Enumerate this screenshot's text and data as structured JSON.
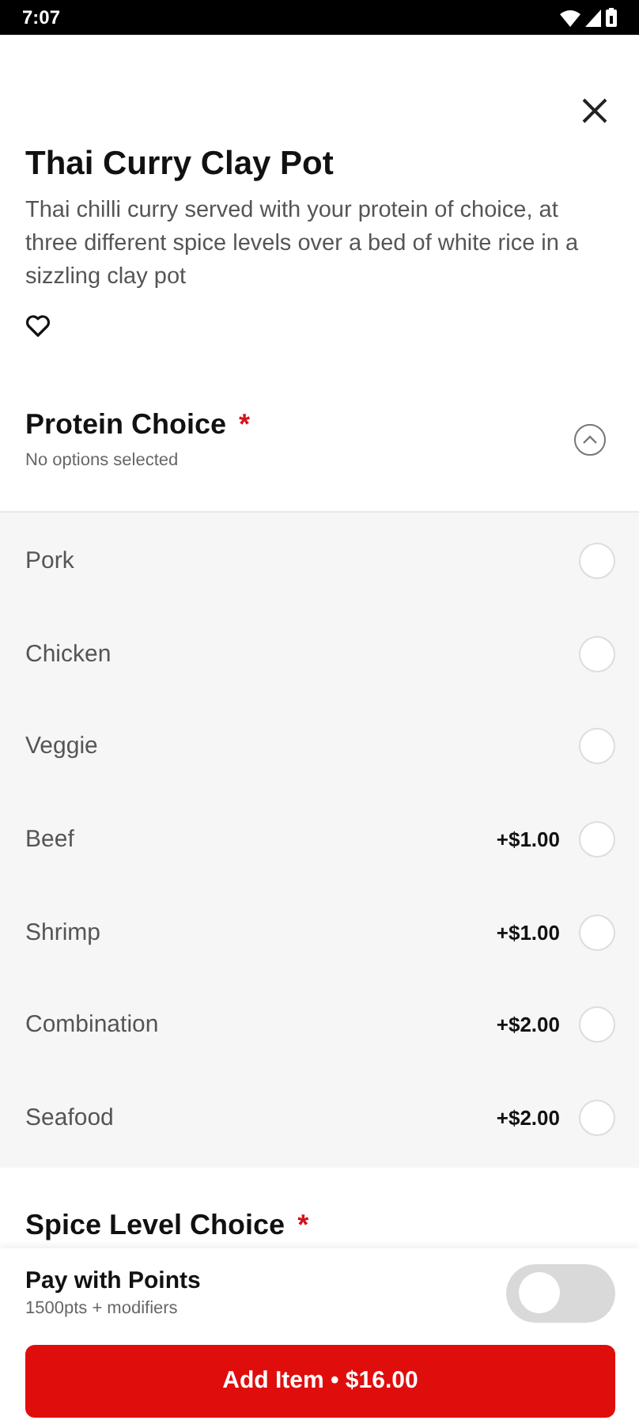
{
  "status_bar": {
    "time": "7:07"
  },
  "item": {
    "title": "Thai Curry Clay Pot",
    "description": "Thai chilli curry served with your protein of choice, at three different spice levels over a bed of white rice in a sizzling clay pot",
    "favorite": false
  },
  "sections": [
    {
      "title": "Protein Choice",
      "required_mark": "*",
      "status": "No options selected",
      "expanded": true,
      "options": [
        {
          "label": "Pork",
          "selected": false
        },
        {
          "label": "Chicken",
          "selected": false
        },
        {
          "label": "Veggie",
          "selected": false
        },
        {
          "label": "Beef",
          "price": "+$1.00",
          "selected": false
        },
        {
          "label": "Shrimp",
          "price": "+$1.00",
          "selected": false
        },
        {
          "label": "Combination",
          "price": "+$2.00",
          "selected": false
        },
        {
          "label": "Seafood",
          "price": "+$2.00",
          "selected": false
        }
      ]
    },
    {
      "title": "Spice Level Choice",
      "required_mark": "*"
    }
  ],
  "footer": {
    "points": {
      "title": "Pay with Points",
      "subtitle": "1500pts + modifiers",
      "on": false
    },
    "add_button": "Add Item • $16.00"
  }
}
